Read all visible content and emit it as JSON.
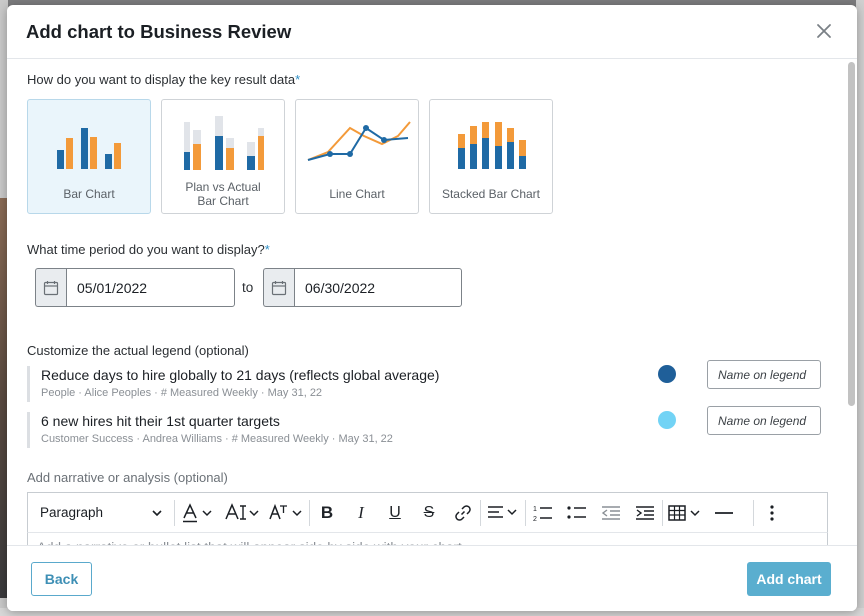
{
  "modal": {
    "title": "Add chart to Business Review"
  },
  "chart_type": {
    "question": "How do you want to display the key result data",
    "required_mark": "*",
    "options": [
      {
        "label": "Bar Chart",
        "selected": true
      },
      {
        "label_line1": "Plan vs Actual",
        "label_line2": "Bar Chart",
        "selected": false
      },
      {
        "label": "Line Chart",
        "selected": false
      },
      {
        "label": "Stacked Bar Chart",
        "selected": false
      }
    ]
  },
  "time_period": {
    "question": "What time period do you want to display?",
    "required_mark": "*",
    "start_date": "05/01/2022",
    "to_label": "to",
    "end_date": "06/30/2022"
  },
  "legend": {
    "heading": "Customize the actual legend (optional)",
    "placeholder": "Name on legend",
    "key_results": [
      {
        "title": "Reduce days to hire globally to 21 days (reflects global average)",
        "meta": "People · Alice Peoples · # Measured Weekly · May 31, 22",
        "color": "#1f5f99"
      },
      {
        "title": "6 new hires hit their 1st quarter targets",
        "meta": "Customer Success · Andrea Williams · # Measured Weekly · May 31, 22",
        "color": "#72d3f5"
      }
    ]
  },
  "narrative": {
    "heading": "Add narrative or analysis (optional)",
    "paragraph_style": "Paragraph",
    "placeholder": "Add a narrative or bullet list that will appear side by side with your chart"
  },
  "footer": {
    "back_label": "Back",
    "add_label": "Add chart"
  },
  "colors": {
    "series_blue": "#1f6aa5",
    "series_orange": "#f39a3a",
    "accent": "#5aaecf"
  }
}
